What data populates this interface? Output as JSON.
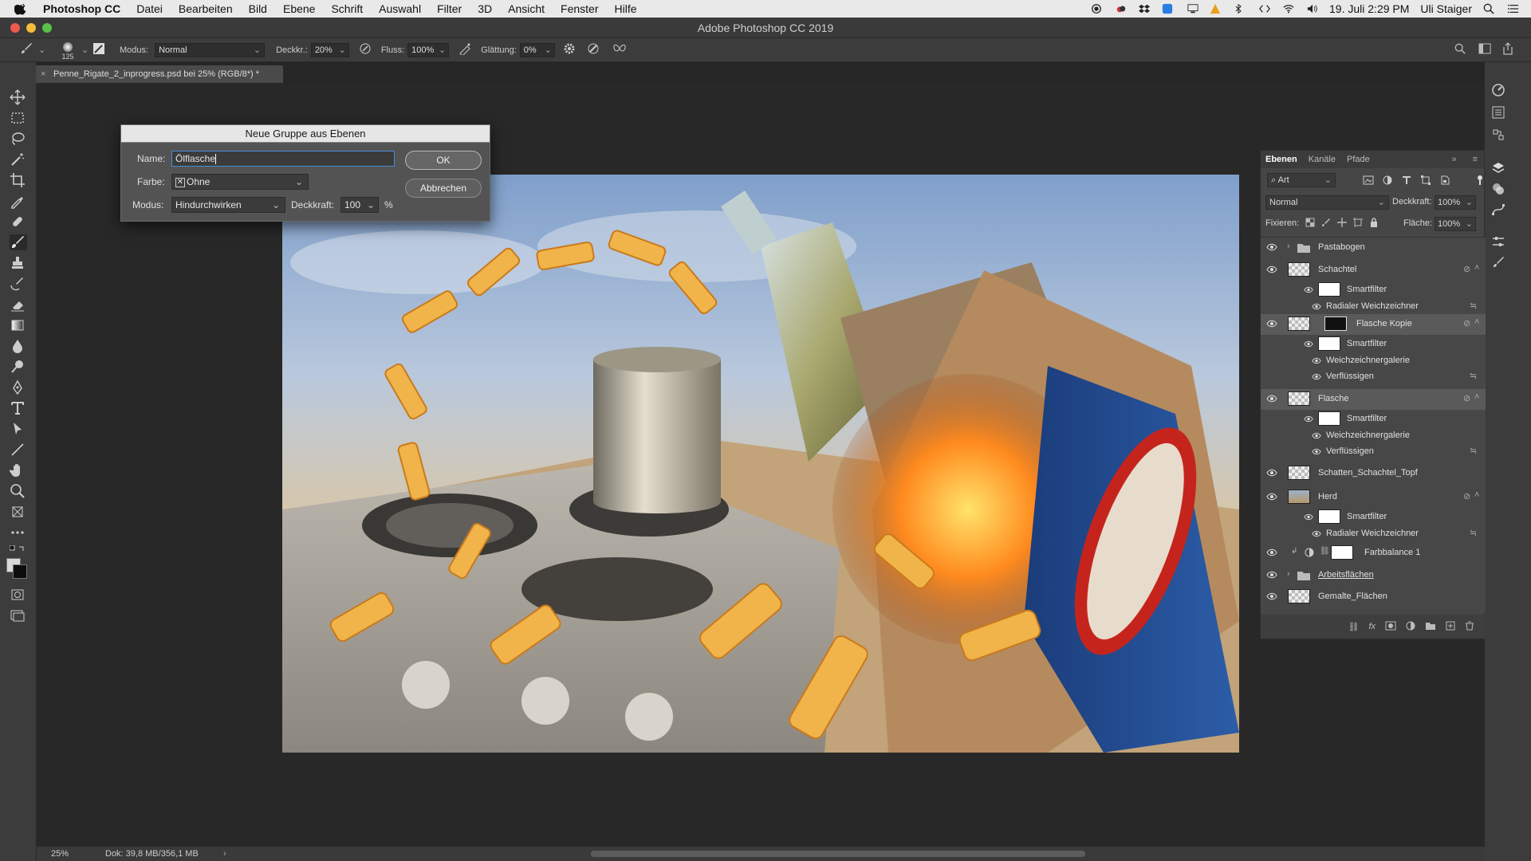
{
  "menubar": {
    "app": "Photoshop CC",
    "items": [
      "Datei",
      "Bearbeiten",
      "Bild",
      "Ebene",
      "Schrift",
      "Auswahl",
      "Filter",
      "3D",
      "Ansicht",
      "Fenster",
      "Hilfe"
    ],
    "datetime": "19. Juli  2:29 PM",
    "user": "Uli Staiger"
  },
  "window": {
    "title": "Adobe Photoshop CC 2019"
  },
  "options": {
    "brush_size": "125",
    "mode_label": "Modus:",
    "mode_value": "Normal",
    "opacity_label": "Deckkr.:",
    "opacity_value": "20%",
    "flow_label": "Fluss:",
    "flow_value": "100%",
    "smoothing_label": "Glättung:",
    "smoothing_value": "0%"
  },
  "document": {
    "tab_title": "Penne_Rigate_2_inprogress.psd bei 25% (RGB/8*) *"
  },
  "dialog": {
    "title": "Neue Gruppe aus Ebenen",
    "name_label": "Name:",
    "name_value": "Ölflasche",
    "color_label": "Farbe:",
    "color_value": "Ohne",
    "mode_label": "Modus:",
    "mode_value": "Hindurchwirken",
    "opacity_label": "Deckkraft:",
    "opacity_value": "100",
    "opacity_unit": "%",
    "ok_label": "OK",
    "cancel_label": "Abbrechen"
  },
  "layers_panel": {
    "tabs": [
      "Ebenen",
      "Kanäle",
      "Pfade"
    ],
    "filter_label": "Art",
    "blend_mode": "Normal",
    "opacity_label": "Deckkraft:",
    "opacity_value": "100%",
    "lock_label": "Fixieren:",
    "fill_label": "Fläche:",
    "fill_value": "100%",
    "layers": [
      {
        "name": "Pastabogen",
        "kind": "group"
      },
      {
        "name": "Schachtel",
        "kind": "smart"
      },
      {
        "name": "Smartfilter",
        "kind": "sub"
      },
      {
        "name": "Radialer Weichzeichner",
        "kind": "filter"
      },
      {
        "name": "Flasche Kopie",
        "kind": "smart-selected"
      },
      {
        "name": "Smartfilter",
        "kind": "sub"
      },
      {
        "name": "Weichzeichnergalerie",
        "kind": "filter"
      },
      {
        "name": "Verflüssigen",
        "kind": "filter"
      },
      {
        "name": "Flasche",
        "kind": "smart-selected"
      },
      {
        "name": "Smartfilter",
        "kind": "sub"
      },
      {
        "name": "Weichzeichnergalerie",
        "kind": "filter"
      },
      {
        "name": "Verflüssigen",
        "kind": "filter"
      },
      {
        "name": "Schatten_Schachtel_Topf",
        "kind": "layer"
      },
      {
        "name": "Herd",
        "kind": "smart"
      },
      {
        "name": "Smartfilter",
        "kind": "sub"
      },
      {
        "name": "Radialer Weichzeichner",
        "kind": "filter"
      },
      {
        "name": "Farbbalance 1",
        "kind": "adjustment"
      },
      {
        "name": "Arbeitsflächen",
        "kind": "group"
      },
      {
        "name": "Gemalte_Flächen",
        "kind": "layer"
      }
    ]
  },
  "status": {
    "zoom": "25%",
    "doc": "Dok: 39,8 MB/356,1 MB"
  },
  "colors": {
    "accent": "#4a8ad9",
    "panel": "#464646",
    "bg": "#262626"
  }
}
